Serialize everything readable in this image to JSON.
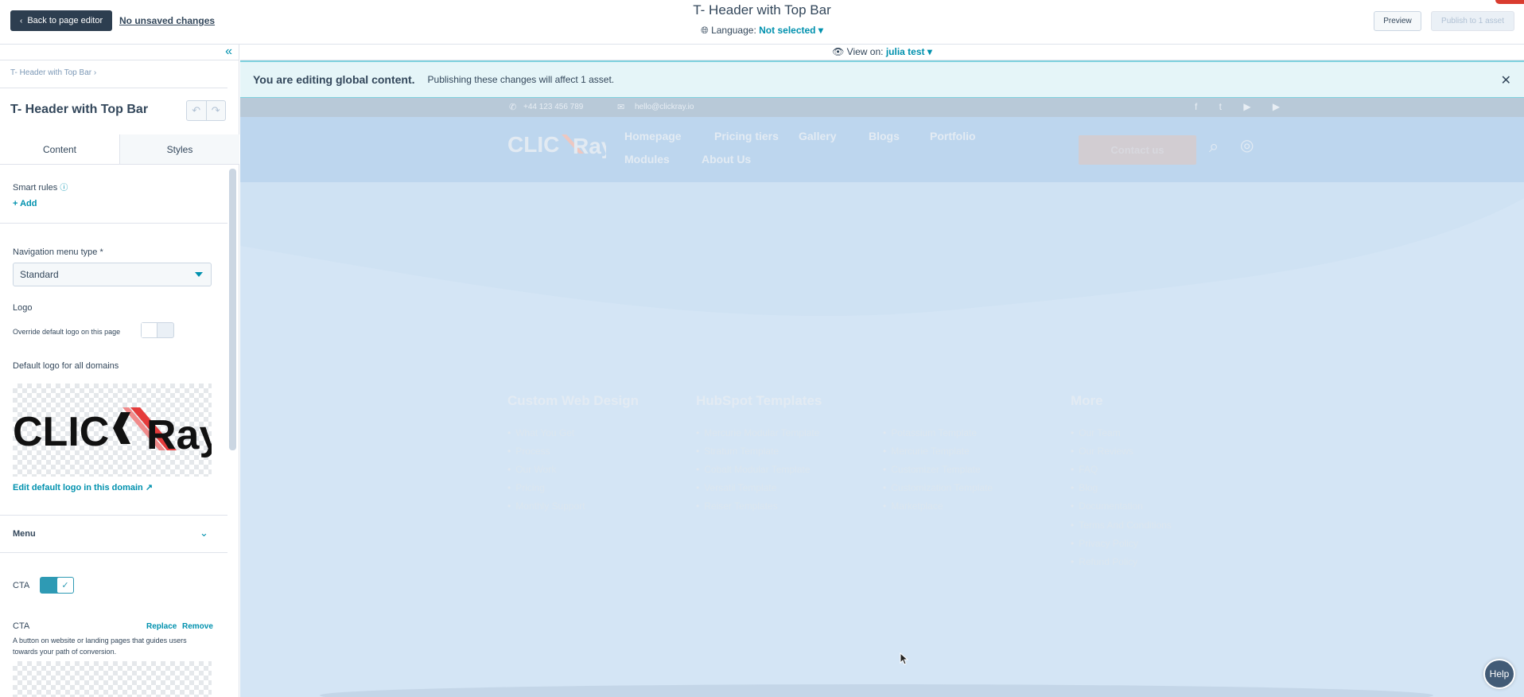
{
  "topbar": {
    "back_label": "Back to page editor",
    "unsaved_label": "No unsaved changes",
    "title": "T- Header with Top Bar",
    "language_label": "Language:",
    "language_value": "Not selected",
    "preview_label": "Preview",
    "publish_label": "Publish to 1 asset"
  },
  "sidebar": {
    "breadcrumb": "T- Header with Top Bar",
    "module_title": "T- Header with Top Bar",
    "tabs": [
      {
        "label": "Content"
      },
      {
        "label": "Styles"
      }
    ],
    "smart_rules_label": "Smart rules",
    "add_label": "Add",
    "nav_type_label": "Navigation menu type *",
    "nav_type_value": "Standard",
    "logo_label": "Logo",
    "override_logo_label": "Override default logo on this page",
    "default_logo_label": "Default logo for all domains",
    "edit_logo_label": "Edit default logo in this domain",
    "menu_label": "Menu",
    "cta_toggle_label": "CTA",
    "cta_section_label": "CTA",
    "replace_label": "Replace",
    "remove_label": "Remove",
    "cta_description": "A button on website or landing pages that guides users towards your path of conversion."
  },
  "canvas": {
    "view_on_label": "View on:",
    "view_on_value": "julia test",
    "banner_title": "You are editing global content.",
    "banner_text": "Publishing these changes will affect 1 asset.",
    "contact_phone": "+44 123 456 789",
    "contact_email": "hello@clickray.io",
    "nav": [
      "Homepage",
      "Pricing tiers",
      "Gallery",
      "Blogs",
      "Portfolio",
      "Modules",
      "About Us"
    ],
    "contact_button": "Contact us",
    "footer_columns": [
      {
        "heading": "Custom Web Design",
        "items": [
          "What You Get",
          "Process",
          "Our Work",
          "Pricing",
          "Monthly Support"
        ]
      },
      {
        "heading": "HubSpot Templates",
        "items": [
          "Mercurie Modular Template",
          "Stratum Template",
          "Cobalt Modular Template",
          "Versatil Template",
          "Reiser Templates"
        ]
      },
      {
        "heading": "",
        "items": [
          "Potassium Template",
          "Mercurie Template",
          "Customizer Template",
          "Customization Template",
          "Marketplace"
        ]
      },
      {
        "heading": "More",
        "items": [
          "Our Team",
          "Our Reviews",
          "FAQ",
          "Blog",
          "Documentation",
          "Terms And Conditions",
          "Privacy Policy",
          "Refund Policy"
        ]
      }
    ],
    "help_label": "Help"
  },
  "colors": {
    "accent": "#0091ae",
    "dark": "#2d3e50",
    "canvas_overlay": "#cfe3f4",
    "toggle_on": "#2e9ab4"
  }
}
